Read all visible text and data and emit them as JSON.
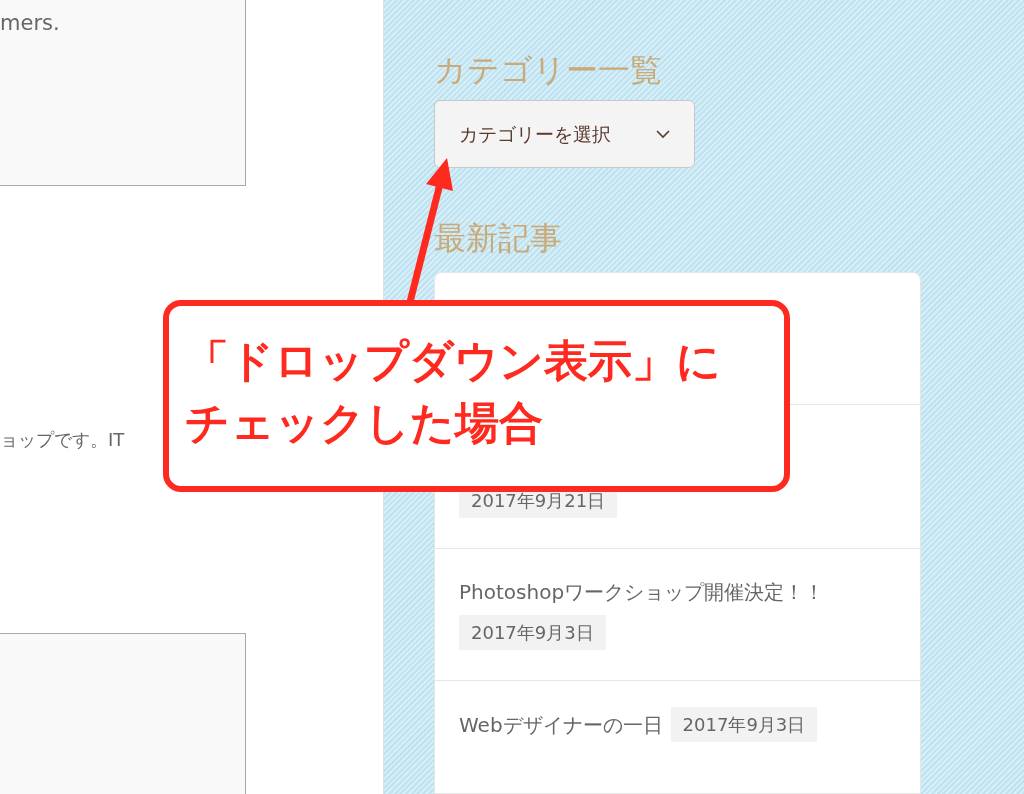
{
  "left": {
    "box_text": "mers.",
    "paragraph": "ョップです。IT"
  },
  "sidebar": {
    "category_heading": "カテゴリー一覧",
    "category_select": {
      "value": "カテゴリーを選択"
    },
    "recent_heading": "最新記事",
    "posts": [
      {
        "kind": "date_only",
        "date": "2017年9月21日"
      },
      {
        "kind": "stacked",
        "title": "Photoshopワークショップ開催決定！！",
        "date": "2017年9月3日"
      },
      {
        "kind": "inline",
        "title": "Webデザイナーの一日",
        "date": "2017年9月3日"
      }
    ]
  },
  "callout": {
    "lines": [
      "「ドロップダウン表示」に",
      "チェックした場合"
    ]
  }
}
